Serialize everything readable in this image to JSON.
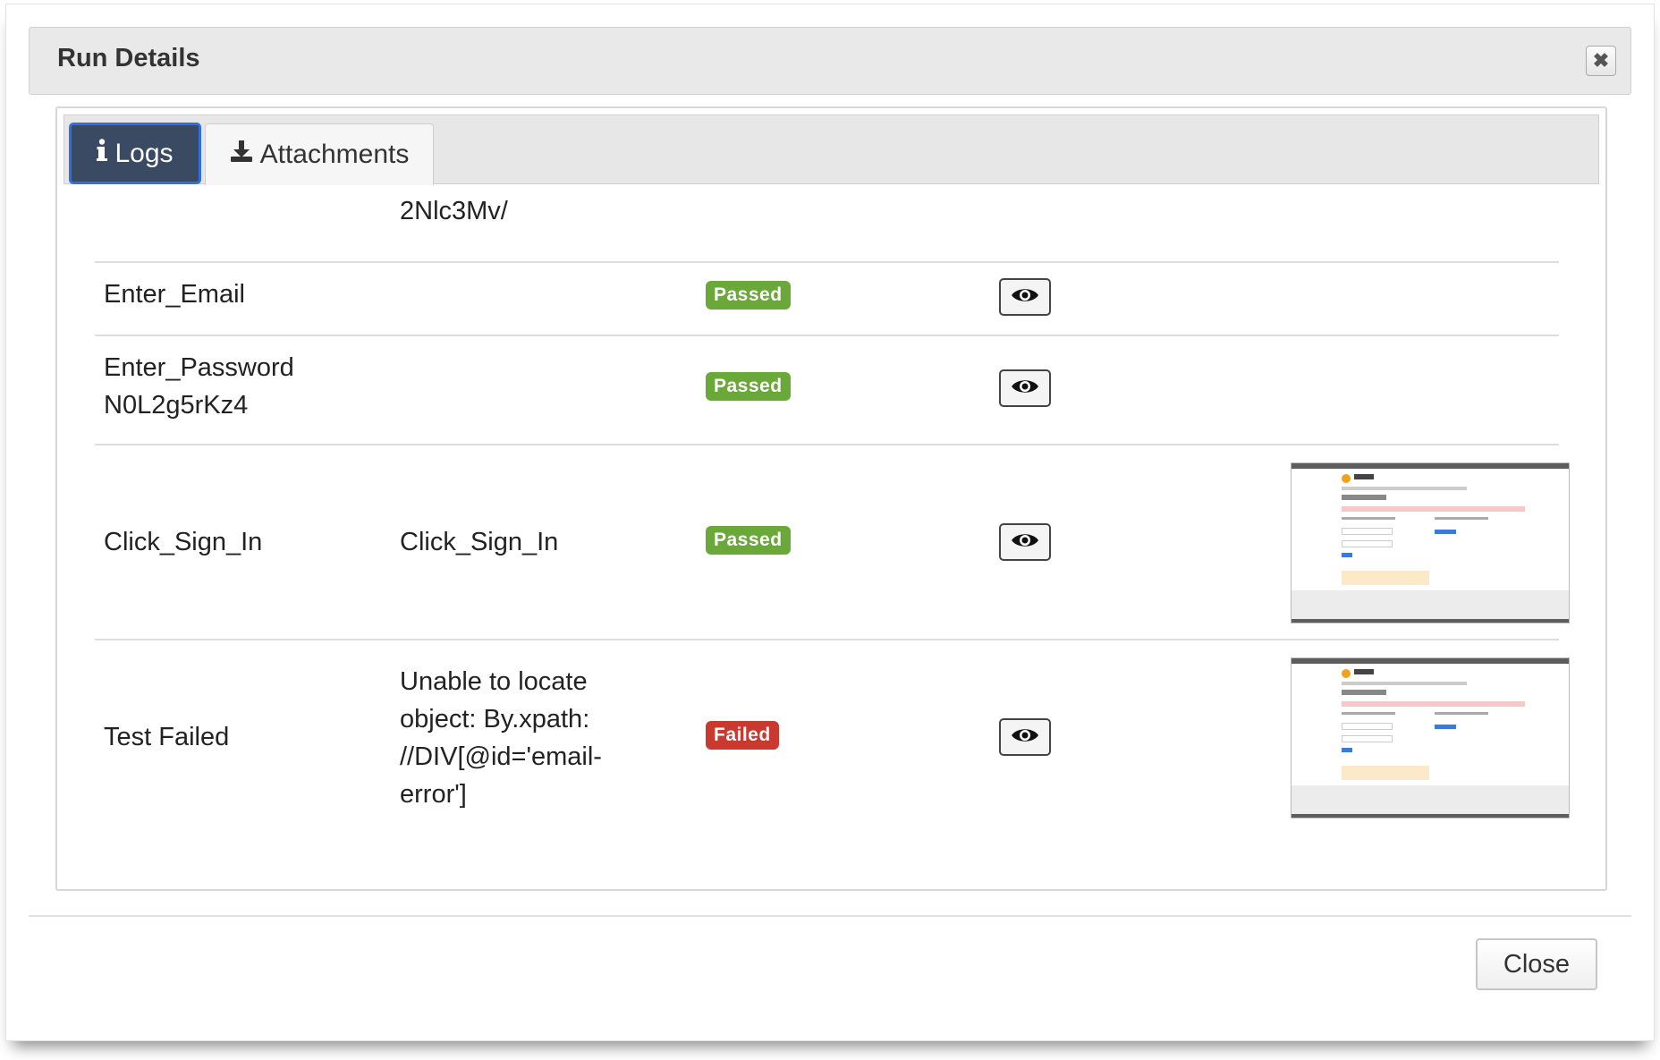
{
  "dialog": {
    "title": "Run Details",
    "close_icon": "close-icon",
    "footer_close_label": "Close"
  },
  "tabs": [
    {
      "label": "Logs",
      "icon": "info-icon",
      "active": true
    },
    {
      "label": "Attachments",
      "icon": "download-icon",
      "active": false
    }
  ],
  "log_rows": [
    {
      "step": "",
      "description": "2Nlc3Mv/",
      "status": "",
      "has_view": false,
      "has_screenshot": false
    },
    {
      "step": "Enter_Email",
      "description": "",
      "status": "Passed",
      "has_view": true,
      "has_screenshot": false
    },
    {
      "step": "Enter_Password\nN0L2g5rKz4",
      "description": "",
      "status": "Passed",
      "has_view": true,
      "has_screenshot": false
    },
    {
      "step": "Click_Sign_In",
      "description": "Click_Sign_In",
      "status": "Passed",
      "has_view": true,
      "has_screenshot": true
    },
    {
      "step": "Test Failed",
      "description": "Unable to locate\nobject: By.xpath:\n//DIV[@id='email-\nerror']",
      "status": "Failed",
      "has_view": true,
      "has_screenshot": true
    }
  ],
  "colors": {
    "passed": "#6aa83a",
    "failed": "#c8392f",
    "active_tab": "#3a4a63"
  },
  "screenshot_thumb": {
    "logo_text": "LUMA",
    "page_heading": "Customer Login"
  }
}
